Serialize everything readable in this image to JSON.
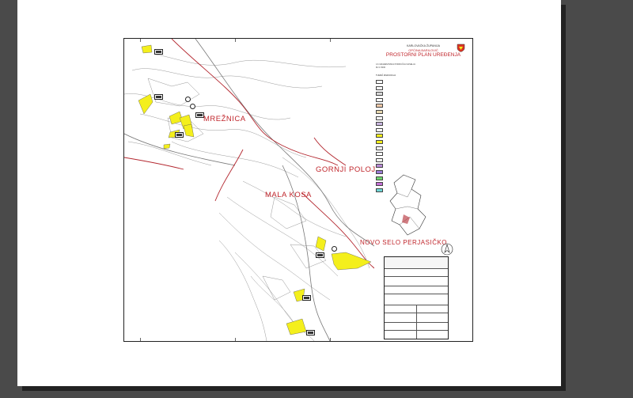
{
  "document": {
    "municipality_line": "KARLOVAČKA ŽUPANIJA",
    "municipality_name": "OPĆINA BARILOVIĆ",
    "plan_title": "PROSTORNI PLAN UREĐENJA",
    "sheet_subtitle": "4.b GRAĐEVINSKA PODRUČJA NASELJA",
    "sheet_meta": "MJ 1:5000"
  },
  "places": {
    "mreznica": "MREŽNICA",
    "gornji_poloj": "GORNJI POLOJ",
    "mala_kosa": "MALA KOSA",
    "novo_selo": "NOVO SELO PERJASIČKO"
  },
  "colors": {
    "build_zone": "#f4ef1c",
    "boundary": "#b3262e",
    "label": "#c0262c",
    "road": "#888888",
    "contour": "#9a9a9a"
  },
  "legend": {
    "heading": "TUMAČ ZNAKOVLJA",
    "items": [
      {
        "color": "#ffffff",
        "label": ""
      },
      {
        "color": "#ffffff",
        "label": ""
      },
      {
        "color": "#d9d9d9",
        "label": ""
      },
      {
        "color": "#ffffff",
        "label": ""
      },
      {
        "color": "#f0c9a8",
        "label": ""
      },
      {
        "color": "#e8d9b0",
        "label": ""
      },
      {
        "color": "#ffffff",
        "label": ""
      },
      {
        "color": "#c9b7e0",
        "label": ""
      },
      {
        "color": "#ffffff",
        "label": ""
      },
      {
        "color": "#f4ef1c",
        "label": ""
      },
      {
        "color": "#f4ef1c",
        "label": ""
      },
      {
        "color": "#ffffff",
        "label": ""
      },
      {
        "color": "#ffffff",
        "label": ""
      },
      {
        "color": "#ffffff",
        "label": ""
      },
      {
        "color": "#b88ad6",
        "label": ""
      },
      {
        "color": "#9b7bd6",
        "label": ""
      },
      {
        "color": "#6fd66f",
        "label": ""
      },
      {
        "color": "#c46fd6",
        "label": ""
      },
      {
        "color": "#6fd6d6",
        "label": ""
      }
    ]
  }
}
